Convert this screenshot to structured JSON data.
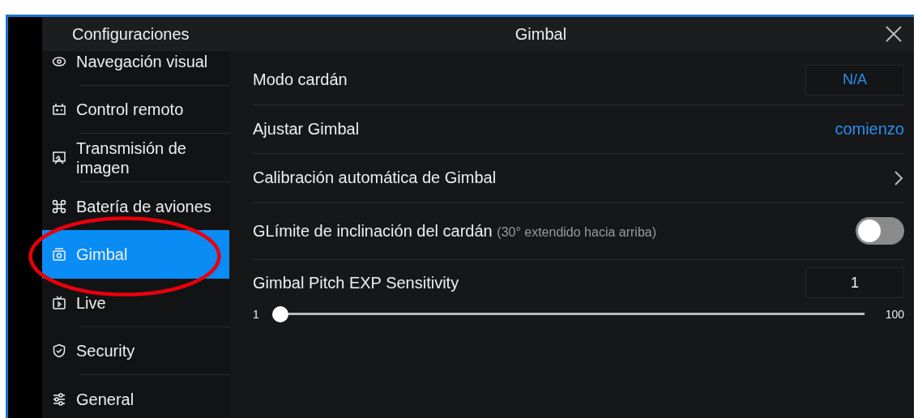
{
  "sidebar": {
    "title": "Configuraciones",
    "items": [
      {
        "label": "Navegación visual",
        "kind": "eye",
        "selected": false
      },
      {
        "label": "Control remoto",
        "kind": "remote",
        "selected": false
      },
      {
        "label": "Transmisión de imagen",
        "kind": "image",
        "selected": false
      },
      {
        "label": "Batería de aviones",
        "kind": "drone",
        "selected": false
      },
      {
        "label": "Gimbal",
        "kind": "camera",
        "selected": true
      },
      {
        "label": "Live",
        "kind": "tv",
        "selected": false
      },
      {
        "label": "Security",
        "kind": "shield",
        "selected": false
      },
      {
        "label": "General",
        "kind": "sliders",
        "selected": false
      }
    ]
  },
  "header": {
    "title": "Gimbal"
  },
  "rows": [
    {
      "kind": "value",
      "label": "Modo cardán",
      "value": "N/A"
    },
    {
      "kind": "link",
      "label": "Ajustar Gimbal",
      "value": "comienzo"
    },
    {
      "kind": "nav",
      "label": "Calibración automática de Gimbal"
    },
    {
      "kind": "toggle",
      "label": "GLímite de inclinación del cardán",
      "note": "(30° extendido hacia arriba)",
      "on": false
    },
    {
      "kind": "slider",
      "label": "Gimbal Pitch EXP Sensitivity",
      "value": "1",
      "min": "1",
      "max": "100",
      "level": 0
    }
  ]
}
